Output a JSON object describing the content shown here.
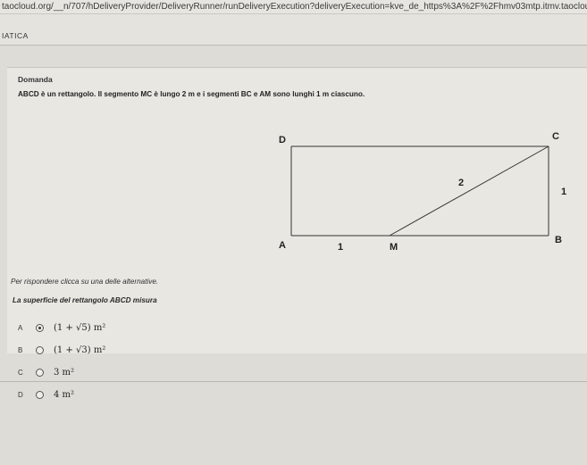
{
  "browser": {
    "url": "taocloud.org/__n/707/hDeliveryProvider/DeliveryRunner/runDeliveryExecution?deliveryExecution=kve_de_https%3A%2F%2Fhmv03mtp.itmv.taocloud.org%2F%23i..."
  },
  "section": {
    "title": "IATICA"
  },
  "question": {
    "header": "Domanda",
    "text": "ABCD è un rettangolo. Il segmento MC è lungo 2 m e i segmenti BC e AM sono lunghi 1 m ciascuno."
  },
  "figure": {
    "vertices": {
      "A": "A",
      "B": "B",
      "C": "C",
      "D": "D",
      "M": "M"
    },
    "labels": {
      "mc_length": "2",
      "bc_length": "1",
      "am_length": "1"
    }
  },
  "instructions": "Per rispondere clicca su una delle alternative.",
  "prompt": "La superficie del rettangolo ABCD misura",
  "choices": [
    {
      "letter": "A",
      "label": "(1 + √5) m²",
      "selected": true
    },
    {
      "letter": "B",
      "label": "(1 + √3) m²",
      "selected": false
    },
    {
      "letter": "C",
      "label": "3 m²",
      "selected": false
    },
    {
      "letter": "D",
      "label": "4 m²",
      "selected": false
    }
  ]
}
